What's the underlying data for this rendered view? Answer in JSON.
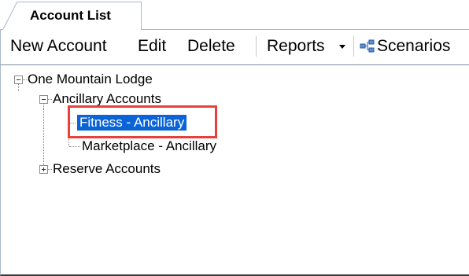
{
  "tab": {
    "label": "Account List"
  },
  "toolbar": {
    "new_account": "New Account",
    "edit": "Edit",
    "delete": "Delete",
    "reports": "Reports",
    "scenarios": "Scenarios"
  },
  "tree": {
    "root": {
      "label": "One Mountain Lodge",
      "expanded": true,
      "children": [
        {
          "label": "Ancillary Accounts",
          "expanded": true,
          "children": [
            {
              "label": "Fitness - Ancillary",
              "selected": true
            },
            {
              "label": "Marketplace - Ancillary",
              "selected": false
            }
          ]
        },
        {
          "label": "Reserve Accounts",
          "expanded": false
        }
      ]
    }
  },
  "colors": {
    "selection": "#0a64d8",
    "highlight_border": "#e8413c",
    "tab_border": "#a9b8cc"
  },
  "icons": {
    "reports_dropdown": "chevron-down-icon",
    "scenarios": "scenario-network-icon",
    "collapse": "minus-box-icon",
    "expand": "plus-box-icon"
  }
}
